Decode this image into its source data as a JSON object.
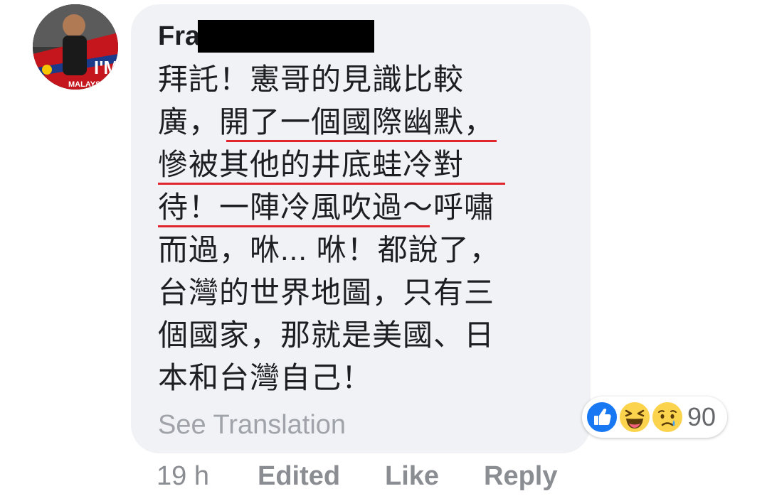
{
  "comment": {
    "author_visible": "Fra",
    "avatar_text": [
      "I'M",
      "MALAYSIA"
    ],
    "lines": [
      [
        "拜託！憲哥的見識比較"
      ],
      [
        "廣，",
        "開了一個國際幽默",
        "，"
      ],
      [
        "慘被其他的井底蛙冷對"
      ],
      [
        "待！一陣冷風吹過",
        "～呼嘯"
      ],
      [
        "而過，咻... 咻！都說了，"
      ],
      [
        "台灣的世界地圖，只有三"
      ],
      [
        "個國家，那就是美國、日"
      ],
      [
        "本和台灣自己！"
      ]
    ],
    "see_translation": "See Translation"
  },
  "reactions": {
    "icons": [
      "like-icon",
      "haha-icon",
      "sad-icon"
    ],
    "count": "90",
    "colors": {
      "like": "#1877f2",
      "emoji": "#fcd34d",
      "tear": "#4ba3f3"
    }
  },
  "actions": {
    "time": "19 h",
    "edited": "Edited",
    "like": "Like",
    "reply": "Reply"
  },
  "colors": {
    "bubble_bg": "#f0f2f5",
    "underline": "#e0262c",
    "text": "#1c1e21",
    "muted": "#8a8d91"
  }
}
